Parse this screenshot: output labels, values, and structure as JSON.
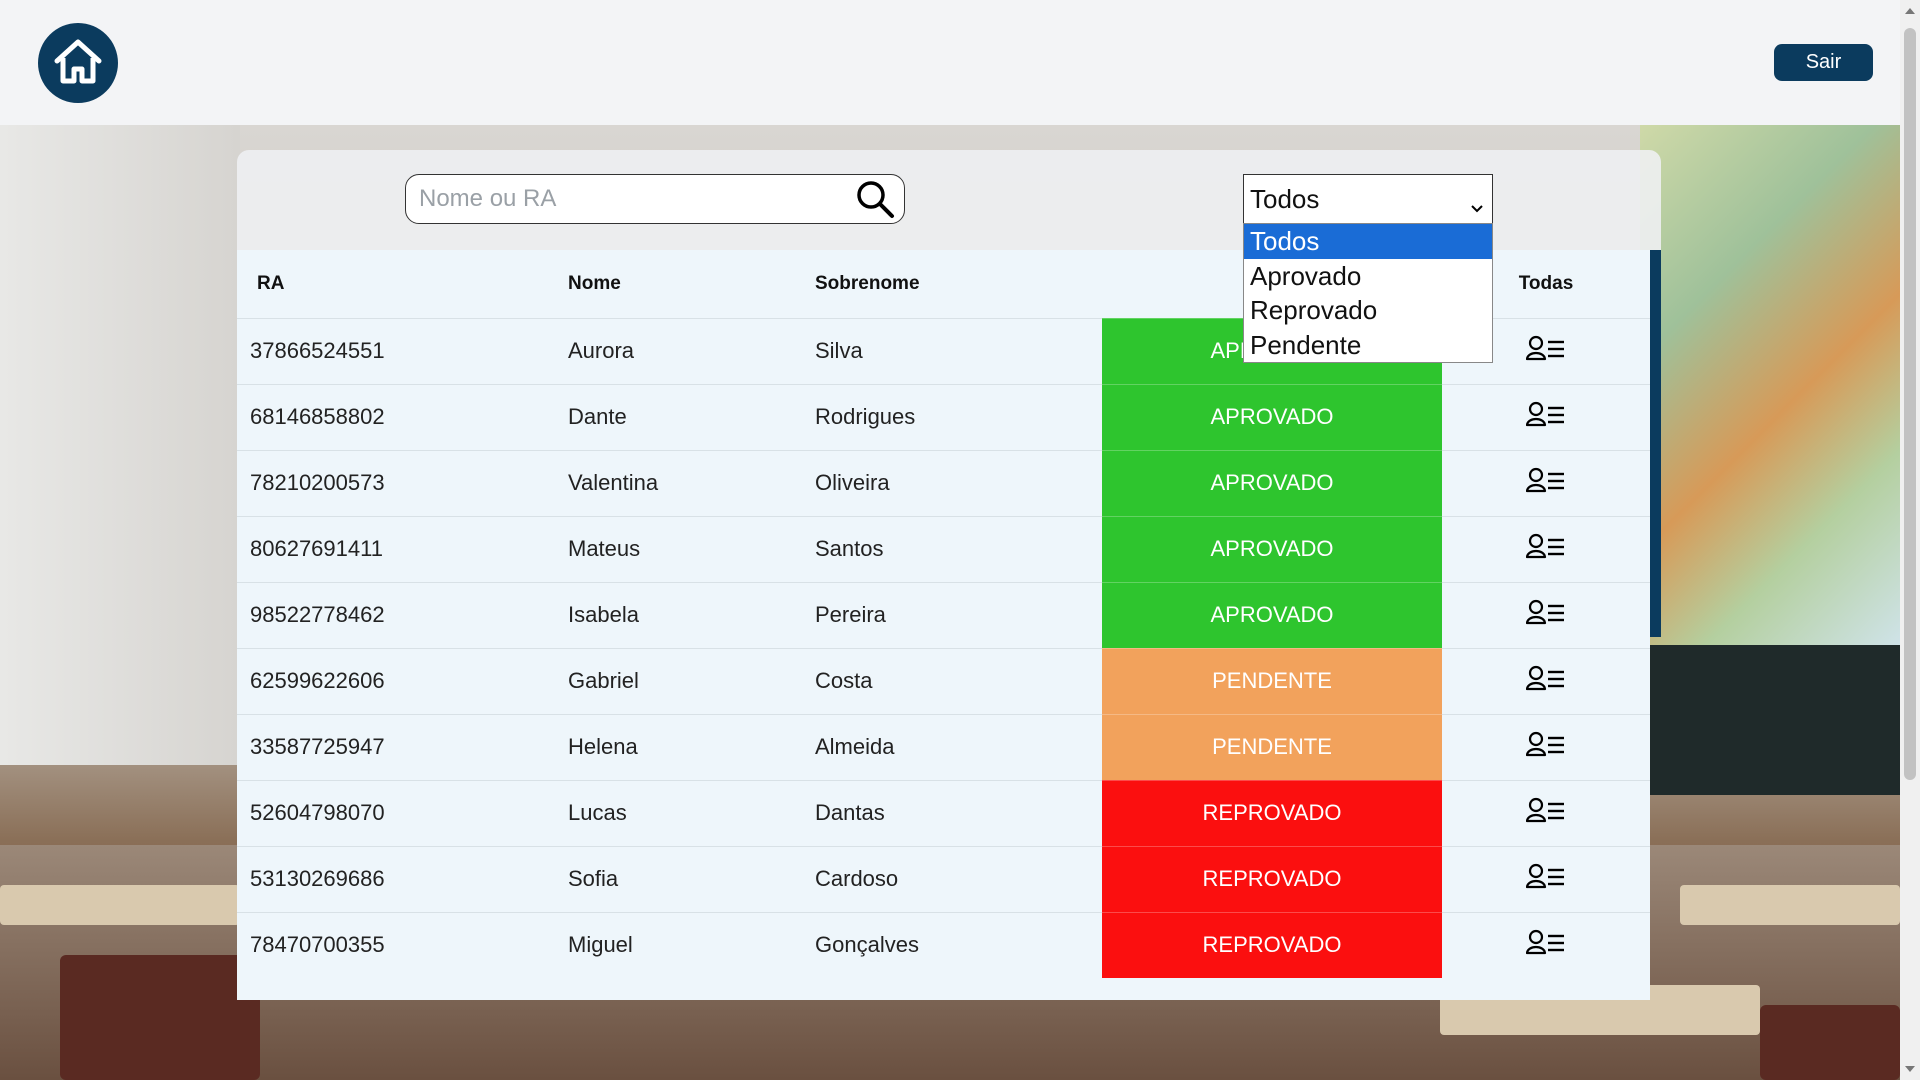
{
  "header": {
    "home_icon": "home-icon",
    "logout_label": "Sair"
  },
  "search": {
    "placeholder": "Nome ou RA",
    "icon": "search-icon"
  },
  "filter": {
    "selected": "Todos",
    "options": [
      "Todos",
      "Aprovado",
      "Reprovado",
      "Pendente"
    ]
  },
  "table": {
    "headers": {
      "ra": "RA",
      "nome": "Nome",
      "sobrenome": "Sobrenome",
      "actions": "Todas"
    },
    "rows": [
      {
        "ra": "37866524551",
        "nome": "Aurora",
        "sobrenome": "Silva",
        "status": "APROVADO"
      },
      {
        "ra": "68146858802",
        "nome": "Dante",
        "sobrenome": "Rodrigues",
        "status": "APROVADO"
      },
      {
        "ra": "78210200573",
        "nome": "Valentina",
        "sobrenome": "Oliveira",
        "status": "APROVADO"
      },
      {
        "ra": "80627691411",
        "nome": "Mateus",
        "sobrenome": "Santos",
        "status": "APROVADO"
      },
      {
        "ra": "98522778462",
        "nome": "Isabela",
        "sobrenome": "Pereira",
        "status": "APROVADO"
      },
      {
        "ra": "62599622606",
        "nome": "Gabriel",
        "sobrenome": "Costa",
        "status": "PENDENTE"
      },
      {
        "ra": "33587725947",
        "nome": "Helena",
        "sobrenome": "Almeida",
        "status": "PENDENTE"
      },
      {
        "ra": "52604798070",
        "nome": "Lucas",
        "sobrenome": "Dantas",
        "status": "REPROVADO"
      },
      {
        "ra": "53130269686",
        "nome": "Sofia",
        "sobrenome": "Cardoso",
        "status": "REPROVADO"
      },
      {
        "ra": "78470700355",
        "nome": "Miguel",
        "sobrenome": "Gonçalves",
        "status": "REPROVADO"
      }
    ]
  },
  "status_colors": {
    "APROVADO": "#2ec52e",
    "PENDENTE": "#f2a25c",
    "REPROVADO": "#fb0f0f"
  },
  "colors": {
    "primary": "#0b3b5e"
  }
}
